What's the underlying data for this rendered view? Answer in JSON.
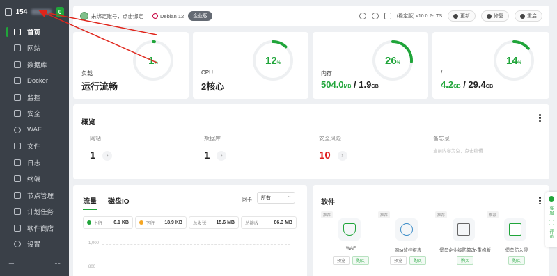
{
  "sidebar": {
    "server_ip": "154",
    "badge": "0",
    "items": [
      {
        "label": "首页",
        "icon": "home-icon"
      },
      {
        "label": "网站",
        "icon": "globe-icon"
      },
      {
        "label": "数据库",
        "icon": "database-icon"
      },
      {
        "label": "Docker",
        "icon": "docker-icon"
      },
      {
        "label": "监控",
        "icon": "monitor-icon"
      },
      {
        "label": "安全",
        "icon": "shield-icon"
      },
      {
        "label": "WAF",
        "icon": "waf-icon"
      },
      {
        "label": "文件",
        "icon": "folder-icon"
      },
      {
        "label": "日志",
        "icon": "log-icon"
      },
      {
        "label": "终端",
        "icon": "terminal-icon"
      },
      {
        "label": "节点管理",
        "icon": "node-icon"
      },
      {
        "label": "计划任务",
        "icon": "schedule-icon"
      },
      {
        "label": "软件商店",
        "icon": "store-icon"
      },
      {
        "label": "设置",
        "icon": "gear-icon"
      }
    ],
    "footer_left": "☰",
    "footer_right": "☷"
  },
  "topbar": {
    "account": "未绑定账号，点击绑定",
    "os": "Debian 12",
    "edition": "企业版",
    "version": "(稳定版) v10.0.2-LTS",
    "update": "更新",
    "repair": "修复",
    "restart": "重启"
  },
  "stats": [
    {
      "label": "负载",
      "value": "运行流畅",
      "percent": "1",
      "fraction": 0.01
    },
    {
      "label": "CPU",
      "value": "2核心",
      "percent": "12",
      "fraction": 0.12
    },
    {
      "label": "内存",
      "used": "504.0",
      "used_unit": "MB",
      "sep": " / ",
      "total": "1.9",
      "total_unit": "GB",
      "percent": "26",
      "fraction": 0.26
    },
    {
      "label": "/",
      "used": "4.2",
      "used_unit": "GB",
      "sep": " / ",
      "total": "29.4",
      "total_unit": "GB",
      "percent": "14",
      "fraction": 0.14
    }
  ],
  "percent_sign": "%",
  "overview": {
    "title": "概览",
    "items": [
      {
        "label": "网站",
        "value": "1"
      },
      {
        "label": "数据库",
        "value": "1"
      },
      {
        "label": "安全风险",
        "value": "10"
      },
      {
        "label": "备忘录",
        "sub": "当前内容为空，点击编辑"
      }
    ]
  },
  "traffic": {
    "tab_traffic": "流量",
    "tab_disk": "磁盘IO",
    "nic_label": "网卡",
    "nic_value": "所有",
    "up_label": "上行",
    "up_value": "6.1 KB",
    "down_label": "下行",
    "down_value": "18.9 KB",
    "sent_label": "总发送",
    "sent_value": "15.6 MB",
    "recv_label": "总接收",
    "recv_value": "86.3 MB",
    "y_ticks": [
      "1,000",
      "800"
    ]
  },
  "software": {
    "title": "软件",
    "items": [
      {
        "tag": "推荐",
        "name": "WAF",
        "btn1": "预览",
        "btn2": "购买"
      },
      {
        "tag": "推荐",
        "name": "网站监控报表",
        "btn1": "预览",
        "btn2": "购买"
      },
      {
        "tag": "推荐",
        "name": "堡垒企业级防篡改-重构版",
        "btn1": "",
        "btn2": "购买"
      },
      {
        "tag": "推荐",
        "name": "堡垒防入侵",
        "btn1": "",
        "btn2": "购买"
      }
    ]
  },
  "float": {
    "service": "客服",
    "review": "评价"
  },
  "colors": {
    "accent": "#20a53a",
    "danger": "#e02020",
    "sidebar": "#3a4048",
    "arrow": "#e0251b"
  }
}
